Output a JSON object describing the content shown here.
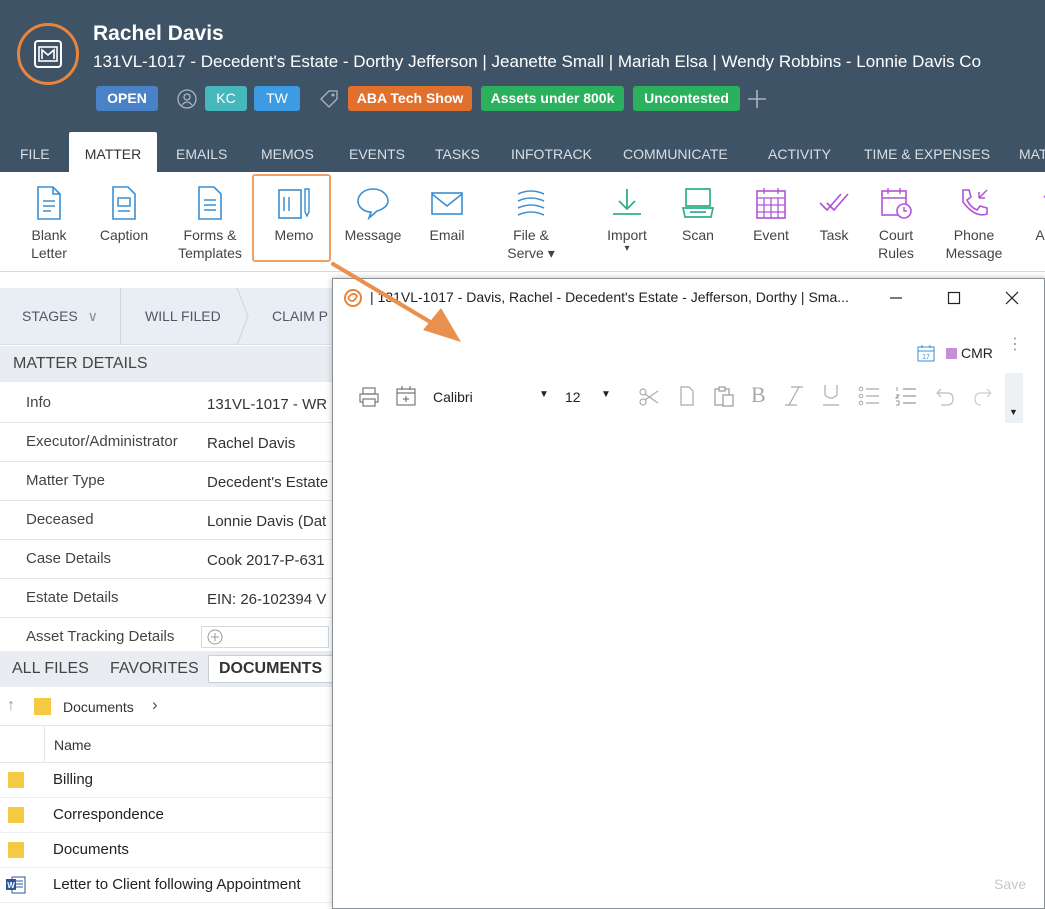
{
  "header": {
    "client_name": "Rachel Davis",
    "matter_line": "131VL-1017 - Decedent's Estate - Dorthy Jefferson | Jeanette Small | Mariah Elsa | Wendy Robbins - Lonnie Davis Co",
    "status": "OPEN",
    "initials": [
      "KC",
      "TW"
    ],
    "tags": [
      "ABA Tech Show",
      "Assets under 800k",
      "Uncontested"
    ]
  },
  "ribbon_tabs": [
    "FILE",
    "MATTER",
    "EMAILS",
    "MEMOS",
    "EVENTS",
    "TASKS",
    "INFOTRACK",
    "COMMUNICATE",
    "ACTIVITY",
    "TIME & EXPENSES",
    "MAT"
  ],
  "toolbar": {
    "blank_letter": [
      "Blank",
      "Letter"
    ],
    "caption": "Caption",
    "forms": [
      "Forms &",
      "Templates"
    ],
    "memo": "Memo",
    "message": "Message",
    "email": "Email",
    "file_serve": [
      "File &",
      "Serve ▾"
    ],
    "import": [
      "Import",
      "▾"
    ],
    "scan": "Scan",
    "event": "Event",
    "task": "Task",
    "court_rules": [
      "Court",
      "Rules"
    ],
    "phone_message": [
      "Phone",
      "Message"
    ],
    "overflow": "A"
  },
  "stages": {
    "label": "STAGES",
    "items": [
      "WILL FILED",
      "CLAIM P"
    ]
  },
  "matter_details": {
    "heading": "MATTER DETAILS",
    "rows": [
      {
        "key": "Info",
        "value": "131VL-1017 - WR"
      },
      {
        "key": "Executor/Administrator",
        "value": "Rachel Davis"
      },
      {
        "key": "Matter Type",
        "value": "Decedent's Estate"
      },
      {
        "key": "Deceased",
        "value": "Lonnie Davis (Dat"
      },
      {
        "key": "Case Details",
        "value": "Cook 2017-P-631"
      },
      {
        "key": "Estate Details",
        "value": "EIN: 26-102394  V"
      },
      {
        "key": "Asset Tracking Details",
        "value": ""
      }
    ]
  },
  "file_tabs": [
    "ALL FILES",
    "FAVORITES",
    "DOCUMENTS"
  ],
  "breadcrumb": "Documents",
  "file_list": {
    "column": "Name",
    "items": [
      {
        "name": "Billing",
        "type": "folder"
      },
      {
        "name": "Correspondence",
        "type": "folder"
      },
      {
        "name": "Documents",
        "type": "folder"
      },
      {
        "name": "Letter to Client following Appointment",
        "type": "word"
      }
    ]
  },
  "memo_window": {
    "title": "| 131VL-1017 - Davis, Rachel - Decedent's Estate - Jefferson, Dorthy | Sma...",
    "cmr_label": "CMR",
    "calendar_day": "17",
    "font": "Calibri",
    "font_size": "12",
    "save_label": "Save"
  },
  "colors": {
    "header_bg": "#3f5366",
    "accent_orange": "#e8843b",
    "status_blue": "#4a82c7",
    "tag_green": "#2bb15d",
    "toolbar_blue": "#3b8fd4",
    "toolbar_purple": "#b154d9"
  }
}
